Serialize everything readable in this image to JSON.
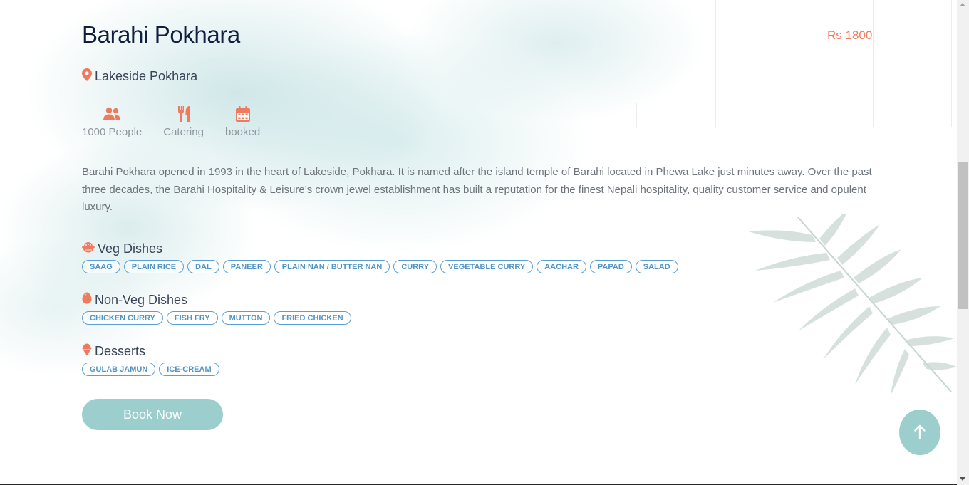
{
  "venue": {
    "name": "Barahi Pokhara",
    "price": "Rs 1800",
    "location": "Lakeside Pokhara",
    "features": [
      {
        "icon": "users-icon",
        "label": "1000 People"
      },
      {
        "icon": "utensils-icon",
        "label": "Catering"
      },
      {
        "icon": "calendar-icon",
        "label": "booked"
      }
    ],
    "description": "Barahi Pokhara opened in 1993 in the heart of Lakeside, Pokhara. It is named after the island temple of Barahi located in Phewa Lake just minutes away. Over the past three decades, the Barahi Hospitality & Leisure’s crown jewel establishment has built a reputation for the finest Nepali hospitality, quality customer service and opulent luxury."
  },
  "menu": {
    "veg": {
      "title": "Veg Dishes",
      "icon": "bowl-icon",
      "items": [
        "SAAG",
        "PLAIN RICE",
        "DAL",
        "PANEER",
        "PLAIN NAN / BUTTER NAN",
        "CURRY",
        "VEGETABLE CURRY",
        "AACHAR",
        "PAPAD",
        "SALAD"
      ]
    },
    "nonveg": {
      "title": "Non-Veg Dishes",
      "icon": "egg-icon",
      "items": [
        "CHICKEN CURRY",
        "FISH FRY",
        "MUTTON",
        "FRIED CHICKEN"
      ]
    },
    "desserts": {
      "title": "Desserts",
      "icon": "ice-cream-icon",
      "items": [
        "GULAB JAMUN",
        "ICE-CREAM"
      ]
    }
  },
  "actions": {
    "book_label": "Book Now",
    "scroll_top_icon": "arrow-up-icon"
  },
  "colors": {
    "accent": "#f07a5e",
    "tag_border": "#5b9fd4",
    "button": "#9bcecc",
    "title": "#0f1f3d"
  }
}
